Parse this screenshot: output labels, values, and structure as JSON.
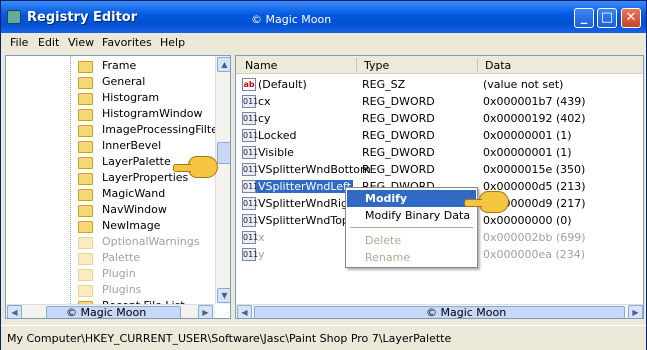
{
  "window": {
    "title": "Registry Editor",
    "watermark_top": "© Magic Moon",
    "buttons": {
      "minimize": "_",
      "maximize": "□",
      "close": "✕"
    }
  },
  "menu": [
    "File",
    "Edit",
    "View",
    "Favorites",
    "Help"
  ],
  "tree": {
    "items": [
      {
        "label": "Frame",
        "faded": false
      },
      {
        "label": "General",
        "faded": false
      },
      {
        "label": "Histogram",
        "faded": false
      },
      {
        "label": "HistogramWindow",
        "faded": false
      },
      {
        "label": "ImageProcessingFilter",
        "faded": false
      },
      {
        "label": "InnerBevel",
        "faded": false
      },
      {
        "label": "LayerPalette",
        "faded": false
      },
      {
        "label": "LayerProperties",
        "faded": false
      },
      {
        "label": "MagicWand",
        "faded": false
      },
      {
        "label": "NavWindow",
        "faded": false
      },
      {
        "label": "NewImage",
        "faded": false
      },
      {
        "label": "OptionalWarnings",
        "faded": true
      },
      {
        "label": "Palette",
        "faded": true
      },
      {
        "label": "Plugin",
        "faded": true
      },
      {
        "label": "Plugins",
        "faded": true
      },
      {
        "label": "Recent File List",
        "faded": false
      }
    ],
    "watermark": "© Magic Moon"
  },
  "list": {
    "columns": [
      "Name",
      "Type",
      "Data"
    ],
    "rows": [
      {
        "icon": "ab",
        "name": "(Default)",
        "type": "REG_SZ",
        "data": "(value not set)"
      },
      {
        "icon": "011",
        "name": "cx",
        "type": "REG_DWORD",
        "data": "0x000001b7 (439)"
      },
      {
        "icon": "011",
        "name": "cy",
        "type": "REG_DWORD",
        "data": "0x00000192 (402)"
      },
      {
        "icon": "011",
        "name": "Locked",
        "type": "REG_DWORD",
        "data": "0x00000001 (1)"
      },
      {
        "icon": "011",
        "name": "Visible",
        "type": "REG_DWORD",
        "data": "0x00000001 (1)"
      },
      {
        "icon": "011",
        "name": "VSplitterWndBottom",
        "type": "REG_DWORD",
        "data": "0x0000015e (350)"
      },
      {
        "icon": "011",
        "name": "VSplitterWndLeft",
        "type": "REG_DWORD",
        "data": "0x000000d5 (213)"
      },
      {
        "icon": "011",
        "name": "VSplitterWndRight",
        "type": "",
        "data": "0x000000d9 (217)"
      },
      {
        "icon": "011",
        "name": "VSplitterWndTop",
        "type": "",
        "data": "0x00000000 (0)"
      },
      {
        "icon": "011",
        "name": "x",
        "type": "",
        "data": "0x000002bb (699)"
      },
      {
        "icon": "011",
        "name": "y",
        "type": "",
        "data": "0x000000ea (234)"
      }
    ],
    "watermark": "© Magic Moon"
  },
  "context_menu": {
    "modify": "Modify",
    "modify_binary": "Modify Binary Data",
    "delete": "Delete",
    "rename": "Rename"
  },
  "status_bar": "My Computer\\HKEY_CURRENT_USER\\Software\\Jasc\\Paint Shop Pro 7\\LayerPalette"
}
